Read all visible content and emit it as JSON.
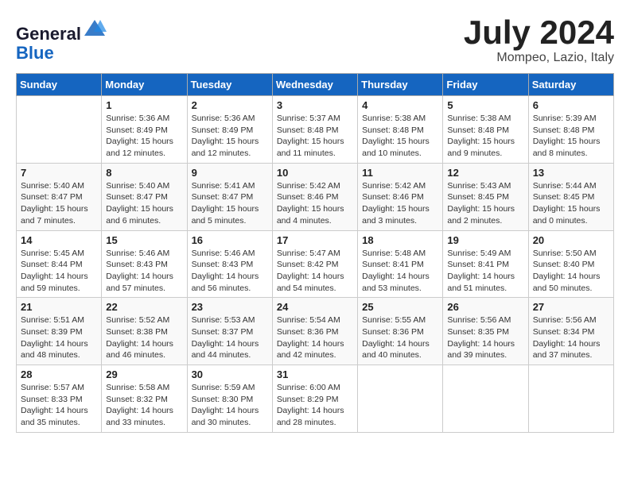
{
  "header": {
    "logo_line1": "General",
    "logo_line2": "Blue",
    "month": "July 2024",
    "location": "Mompeo, Lazio, Italy"
  },
  "weekdays": [
    "Sunday",
    "Monday",
    "Tuesday",
    "Wednesday",
    "Thursday",
    "Friday",
    "Saturday"
  ],
  "weeks": [
    [
      {
        "day": "",
        "detail": ""
      },
      {
        "day": "1",
        "detail": "Sunrise: 5:36 AM\nSunset: 8:49 PM\nDaylight: 15 hours\nand 12 minutes."
      },
      {
        "day": "2",
        "detail": "Sunrise: 5:36 AM\nSunset: 8:49 PM\nDaylight: 15 hours\nand 12 minutes."
      },
      {
        "day": "3",
        "detail": "Sunrise: 5:37 AM\nSunset: 8:48 PM\nDaylight: 15 hours\nand 11 minutes."
      },
      {
        "day": "4",
        "detail": "Sunrise: 5:38 AM\nSunset: 8:48 PM\nDaylight: 15 hours\nand 10 minutes."
      },
      {
        "day": "5",
        "detail": "Sunrise: 5:38 AM\nSunset: 8:48 PM\nDaylight: 15 hours\nand 9 minutes."
      },
      {
        "day": "6",
        "detail": "Sunrise: 5:39 AM\nSunset: 8:48 PM\nDaylight: 15 hours\nand 8 minutes."
      }
    ],
    [
      {
        "day": "7",
        "detail": "Sunrise: 5:40 AM\nSunset: 8:47 PM\nDaylight: 15 hours\nand 7 minutes."
      },
      {
        "day": "8",
        "detail": "Sunrise: 5:40 AM\nSunset: 8:47 PM\nDaylight: 15 hours\nand 6 minutes."
      },
      {
        "day": "9",
        "detail": "Sunrise: 5:41 AM\nSunset: 8:47 PM\nDaylight: 15 hours\nand 5 minutes."
      },
      {
        "day": "10",
        "detail": "Sunrise: 5:42 AM\nSunset: 8:46 PM\nDaylight: 15 hours\nand 4 minutes."
      },
      {
        "day": "11",
        "detail": "Sunrise: 5:42 AM\nSunset: 8:46 PM\nDaylight: 15 hours\nand 3 minutes."
      },
      {
        "day": "12",
        "detail": "Sunrise: 5:43 AM\nSunset: 8:45 PM\nDaylight: 15 hours\nand 2 minutes."
      },
      {
        "day": "13",
        "detail": "Sunrise: 5:44 AM\nSunset: 8:45 PM\nDaylight: 15 hours\nand 0 minutes."
      }
    ],
    [
      {
        "day": "14",
        "detail": "Sunrise: 5:45 AM\nSunset: 8:44 PM\nDaylight: 14 hours\nand 59 minutes."
      },
      {
        "day": "15",
        "detail": "Sunrise: 5:46 AM\nSunset: 8:43 PM\nDaylight: 14 hours\nand 57 minutes."
      },
      {
        "day": "16",
        "detail": "Sunrise: 5:46 AM\nSunset: 8:43 PM\nDaylight: 14 hours\nand 56 minutes."
      },
      {
        "day": "17",
        "detail": "Sunrise: 5:47 AM\nSunset: 8:42 PM\nDaylight: 14 hours\nand 54 minutes."
      },
      {
        "day": "18",
        "detail": "Sunrise: 5:48 AM\nSunset: 8:41 PM\nDaylight: 14 hours\nand 53 minutes."
      },
      {
        "day": "19",
        "detail": "Sunrise: 5:49 AM\nSunset: 8:41 PM\nDaylight: 14 hours\nand 51 minutes."
      },
      {
        "day": "20",
        "detail": "Sunrise: 5:50 AM\nSunset: 8:40 PM\nDaylight: 14 hours\nand 50 minutes."
      }
    ],
    [
      {
        "day": "21",
        "detail": "Sunrise: 5:51 AM\nSunset: 8:39 PM\nDaylight: 14 hours\nand 48 minutes."
      },
      {
        "day": "22",
        "detail": "Sunrise: 5:52 AM\nSunset: 8:38 PM\nDaylight: 14 hours\nand 46 minutes."
      },
      {
        "day": "23",
        "detail": "Sunrise: 5:53 AM\nSunset: 8:37 PM\nDaylight: 14 hours\nand 44 minutes."
      },
      {
        "day": "24",
        "detail": "Sunrise: 5:54 AM\nSunset: 8:36 PM\nDaylight: 14 hours\nand 42 minutes."
      },
      {
        "day": "25",
        "detail": "Sunrise: 5:55 AM\nSunset: 8:36 PM\nDaylight: 14 hours\nand 40 minutes."
      },
      {
        "day": "26",
        "detail": "Sunrise: 5:56 AM\nSunset: 8:35 PM\nDaylight: 14 hours\nand 39 minutes."
      },
      {
        "day": "27",
        "detail": "Sunrise: 5:56 AM\nSunset: 8:34 PM\nDaylight: 14 hours\nand 37 minutes."
      }
    ],
    [
      {
        "day": "28",
        "detail": "Sunrise: 5:57 AM\nSunset: 8:33 PM\nDaylight: 14 hours\nand 35 minutes."
      },
      {
        "day": "29",
        "detail": "Sunrise: 5:58 AM\nSunset: 8:32 PM\nDaylight: 14 hours\nand 33 minutes."
      },
      {
        "day": "30",
        "detail": "Sunrise: 5:59 AM\nSunset: 8:30 PM\nDaylight: 14 hours\nand 30 minutes."
      },
      {
        "day": "31",
        "detail": "Sunrise: 6:00 AM\nSunset: 8:29 PM\nDaylight: 14 hours\nand 28 minutes."
      },
      {
        "day": "",
        "detail": ""
      },
      {
        "day": "",
        "detail": ""
      },
      {
        "day": "",
        "detail": ""
      }
    ]
  ]
}
